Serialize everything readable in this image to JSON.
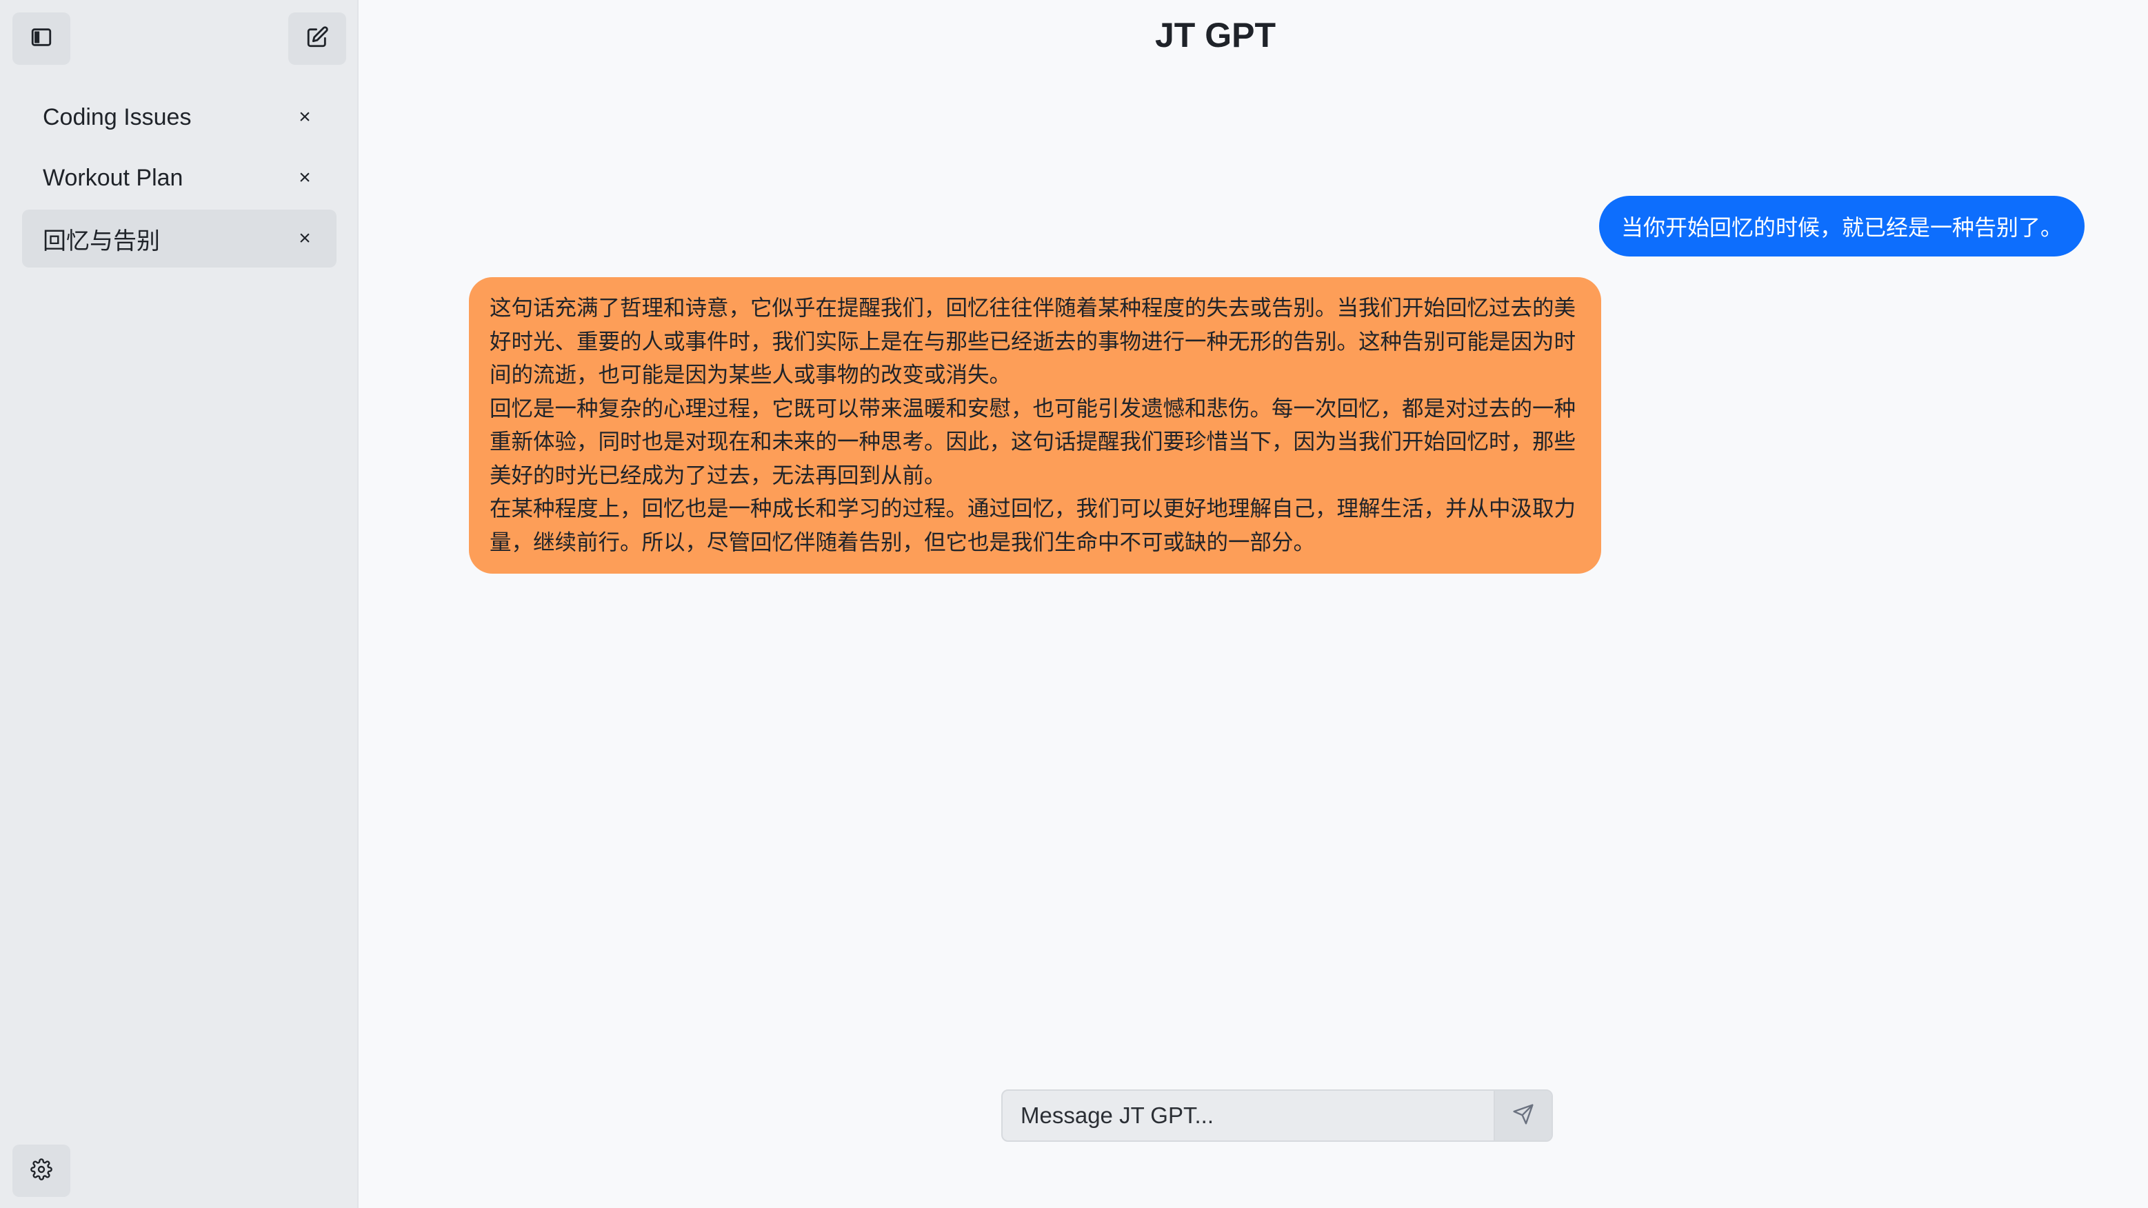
{
  "app": {
    "title": "JT GPT"
  },
  "sidebar": {
    "toggle_icon": "sidebar-toggle-icon",
    "new_chat_icon": "edit-icon",
    "settings_icon": "gear-icon",
    "conversations": [
      {
        "label": "Coding Issues",
        "close": "×",
        "active": false
      },
      {
        "label": "Workout Plan",
        "close": "×",
        "active": false
      },
      {
        "label": "回忆与告别",
        "close": "×",
        "active": true
      }
    ]
  },
  "chat": {
    "messages": [
      {
        "role": "user",
        "text": "当你开始回忆的时候，就已经是一种告别了。"
      },
      {
        "role": "assistant",
        "paragraphs": [
          "这句话充满了哲理和诗意，它似乎在提醒我们，回忆往往伴随着某种程度的失去或告别。当我们开始回忆过去的美好时光、重要的人或事件时，我们实际上是在与那些已经逝去的事物进行一种无形的告别。这种告别可能是因为时间的流逝，也可能是因为某些人或事物的改变或消失。",
          "回忆是一种复杂的心理过程，它既可以带来温暖和安慰，也可能引发遗憾和悲伤。每一次回忆，都是对过去的一种重新体验，同时也是对现在和未来的一种思考。因此，这句话提醒我们要珍惜当下，因为当我们开始回忆时，那些美好的时光已经成为了过去，无法再回到从前。",
          "在某种程度上，回忆也是一种成长和学习的过程。通过回忆，我们可以更好地理解自己，理解生活，并从中汲取力量，继续前行。所以，尽管回忆伴随着告别，但它也是我们生命中不可或缺的一部分。"
        ]
      }
    ]
  },
  "composer": {
    "placeholder": "Message JT GPT...",
    "value": "",
    "send_icon": "send-icon"
  },
  "colors": {
    "user_bubble": "#0d6efd",
    "assistant_bubble": "#fd9e58",
    "sidebar_bg": "#e9ebee",
    "main_bg": "#f8f9fb"
  }
}
